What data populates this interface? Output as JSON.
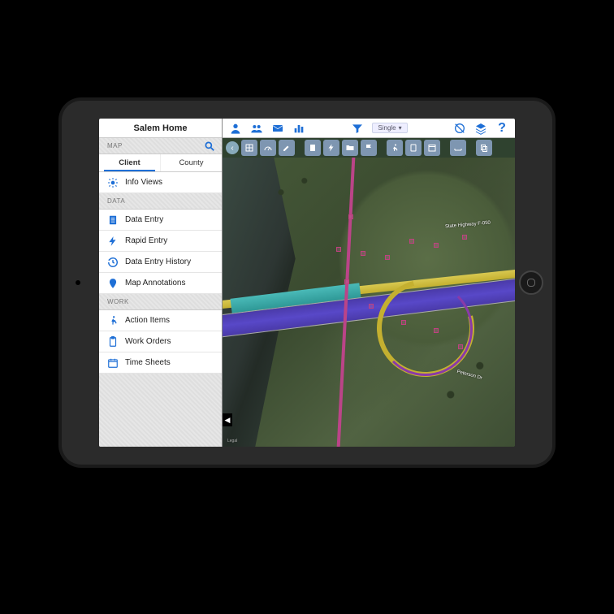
{
  "app_title": "Salem Home",
  "sections": {
    "map": {
      "header": "MAP",
      "tabs": [
        "Client",
        "County"
      ],
      "active_tab": 0,
      "items": [
        {
          "icon": "gear",
          "label": "Info Views"
        }
      ]
    },
    "data": {
      "header": "DATA",
      "items": [
        {
          "icon": "clipboard",
          "label": "Data Entry"
        },
        {
          "icon": "bolt",
          "label": "Rapid Entry"
        },
        {
          "icon": "history",
          "label": "Data Entry History"
        },
        {
          "icon": "pin",
          "label": "Map Annotations"
        }
      ]
    },
    "work": {
      "header": "WORK",
      "items": [
        {
          "icon": "run",
          "label": "Action Items"
        },
        {
          "icon": "clipboard",
          "label": "Work Orders"
        },
        {
          "icon": "calendar",
          "label": "Time Sheets"
        }
      ]
    }
  },
  "topbar": {
    "selector_label": "Single",
    "icons": [
      "user",
      "group",
      "mail",
      "chart",
      "filter",
      "target",
      "layers",
      "help"
    ]
  },
  "map": {
    "road_labels": [
      "State Highway F-050",
      "Peterson Dr"
    ],
    "legal": "Legal",
    "collapse": "◀"
  },
  "colors": {
    "accent": "#1e6fd6"
  }
}
